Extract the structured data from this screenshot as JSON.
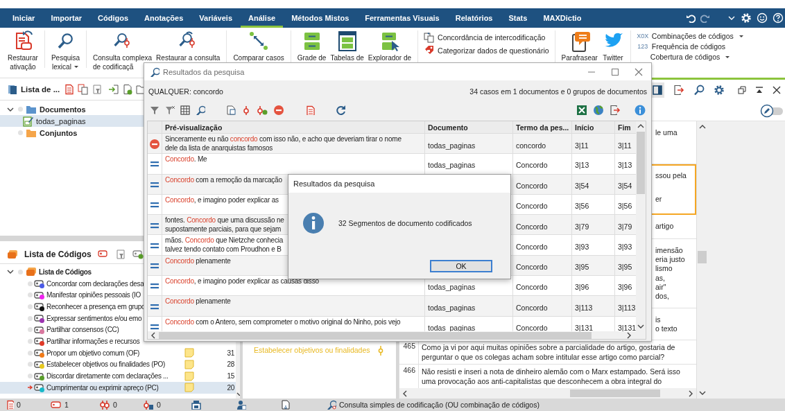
{
  "menu_bar": {
    "tabs": [
      {
        "label": "Iniciar",
        "selected": false
      },
      {
        "label": "Importar",
        "selected": false
      },
      {
        "label": "Códigos",
        "selected": false
      },
      {
        "label": "Anotações",
        "selected": false
      },
      {
        "label": "Variáveis",
        "selected": false
      },
      {
        "label": "Análise",
        "selected": true
      },
      {
        "label": "Métodos Mistos",
        "selected": false
      },
      {
        "label": "Ferramentas Visuais",
        "selected": false
      },
      {
        "label": "Relatórios",
        "selected": false
      },
      {
        "label": "Stats",
        "selected": false
      },
      {
        "label": "MAXDictio",
        "selected": false
      }
    ]
  },
  "ribbon": {
    "items": [
      {
        "kind": "large",
        "lines": [
          "Restaurar",
          "ativação"
        ],
        "dropdown": false
      },
      {
        "kind": "large",
        "lines": [
          "Pesquisa",
          "lexical"
        ],
        "dropdown": true
      },
      {
        "kind": "large",
        "lines": [
          "Consulta complexa",
          "de codificaçã"
        ],
        "dropdown": false
      },
      {
        "kind": "large",
        "lines": [
          "Restaurar a consulta"
        ],
        "dropdown": false
      },
      {
        "kind": "large",
        "lines": [
          "Comparar casos"
        ],
        "dropdown": false
      },
      {
        "kind": "large",
        "lines": [
          "Grade de"
        ],
        "dropdown": false
      },
      {
        "kind": "large",
        "lines": [
          "Tabelas de"
        ],
        "dropdown": false
      },
      {
        "kind": "large",
        "lines": [
          "Explorador de"
        ],
        "dropdown": false
      },
      {
        "kind": "stack",
        "entries": [
          {
            "label": "Concordância de intercodificação",
            "dropdown": false
          },
          {
            "label": "Categorizar dados de questionário",
            "dropdown": false
          }
        ]
      },
      {
        "kind": "large",
        "lines": [
          "Parafrasear"
        ],
        "dropdown": false
      },
      {
        "kind": "large",
        "lines": [
          "Twitter"
        ],
        "dropdown": false
      },
      {
        "kind": "stack",
        "entries": [
          {
            "glyph": "X0X",
            "label": "Combinações de códigos",
            "dropdown": true
          },
          {
            "glyph": "123",
            "label": "Frequência de códigos",
            "dropdown": false
          },
          {
            "label": "Cobertura de códigos",
            "dropdown": true
          }
        ]
      }
    ]
  },
  "document_browser": {
    "title": "Lista de ...",
    "tree": [
      {
        "label": "Documentos",
        "expanded": true,
        "selected": false,
        "children": [
          {
            "label": "todas_paginas",
            "selected": true
          }
        ]
      },
      {
        "label": "Conjuntos",
        "selected": false
      }
    ]
  },
  "code_system": {
    "title": "Lista de Códigos",
    "root": {
      "label": "Lista de Códigos",
      "expanded": true,
      "children": [
        {
          "label": "Concordar com declarações desa",
          "color": "#4a5ae6",
          "selected": false
        },
        {
          "label": "Manifestar opiniões pessoais (IO",
          "color": "#ee22ee",
          "selected": false
        },
        {
          "label": "Reconhecer a presença em grupo",
          "color": "#111111",
          "selected": false
        },
        {
          "label": "Expressar sentimentos e/ou emo",
          "color": "#9b34b0",
          "selected": false
        },
        {
          "label": "Partilhar consensos (CC)",
          "color": "#d9789f",
          "selected": false
        },
        {
          "label": "Partilhar informações e recursos",
          "color": "#e03a28",
          "selected": false
        },
        {
          "label": "Propor um objetivo comum (OF)",
          "color": "#f07a18",
          "selected": false,
          "memo": true,
          "count": "31"
        },
        {
          "label": "Estabelecer objetivos ou finalidades (PO)",
          "color": "#e6c81e",
          "selected": false,
          "memo": true,
          "count": "28"
        },
        {
          "label": "Discordar diretamente com declarações ...",
          "color": "#5a9e2a",
          "selected": false,
          "memo": true,
          "count": "15"
        },
        {
          "label": "Cumprimentar ou exprimir apreço (PC)",
          "color": "#18b8c8",
          "selected": true,
          "memo": true,
          "count": "20"
        }
      ]
    }
  },
  "retrieved_segments": {
    "code_label": "Estabelecer objetivos ou finalidades"
  },
  "document_viewer": {
    "fragments": [
      {
        "lines": [
          "le uma"
        ],
        "highlighted": false
      },
      {
        "lines": [
          "ssou pela",
          "er"
        ],
        "highlighted": true
      },
      {
        "lines": [
          "artigo"
        ],
        "highlighted": false
      },
      {
        "lines": [
          "imensão",
          "eria justo",
          "lismo",
          "as,",
          "air\"",
          "dos,"
        ],
        "highlighted": false
      },
      {
        "lines": [
          "is",
          "o texto"
        ],
        "highlighted": false
      }
    ],
    "paragraphs": [
      {
        "number": "465",
        "text": "Como ja vi por aqui muitas opiniões sobre a parcialidade do artigo, gostaria de perguntar o que os colegas acham sobre intitular esse artigo como parcial?"
      },
      {
        "number": "466",
        "text": "Não resisti e inseri a nota de dinheiro alemão com o Marx estampado. Será isso uma provocação aos anti-capitalistas que desconhecem a obra integral do"
      }
    ]
  },
  "status_bar": {
    "counters": [
      "0",
      "1",
      "0",
      "0"
    ],
    "query": "Consulta simples de codificação (OU combinação de códigos)"
  },
  "results_window": {
    "title": "Resultados da pesquisa",
    "query": "QUALQUER: concordo",
    "summary": "34 casos em 1 documentos e 0 grupos de documentos",
    "columns": [
      "Pré-visualização",
      "Documento",
      "Termo da pes...",
      "Início",
      "Fim"
    ],
    "rows": [
      {
        "kind": "excluded",
        "preview": [
          {
            "text": "Sinceramente eu não ",
            "hit": false
          },
          {
            "text": "concordo",
            "hit": true
          },
          {
            "text": " com isso não, e acho que deveriam tirar o nome\ndele da lista de anarquistas famosos",
            "hit": false
          }
        ],
        "document": "todas_paginas",
        "term": "concordo",
        "start": "3|11",
        "end": "3|11"
      },
      {
        "kind": "match",
        "preview": [
          {
            "text": "Concordo",
            "hit": true
          },
          {
            "text": ". Me",
            "hit": false
          }
        ],
        "document": "todas_paginas",
        "term": "Concordo",
        "start": "3|13",
        "end": "3|13"
      },
      {
        "kind": "match",
        "preview": [
          {
            "text": "Concordo",
            "hit": true
          },
          {
            "text": " com a remoção da marcação",
            "hit": false
          }
        ],
        "term": "Concordo",
        "start": "3|54",
        "end": "3|54"
      },
      {
        "kind": "match",
        "preview": [
          {
            "text": "Concordo",
            "hit": true
          },
          {
            "text": ", e imagino poder explicar as",
            "hit": false
          }
        ],
        "term": "Concordo",
        "start": "3|56",
        "end": "3|56"
      },
      {
        "kind": "match",
        "preview": [
          {
            "text": "fontes. ",
            "hit": false
          },
          {
            "text": "Concordo",
            "hit": true
          },
          {
            "text": " que uma discussão ne\nsupostamente parciais, para que sejam",
            "hit": false
          }
        ],
        "term": "Concordo",
        "start": "3|79",
        "end": "3|79"
      },
      {
        "kind": "match",
        "preview": [
          {
            "text": "mãos. ",
            "hit": false
          },
          {
            "text": "Concordo",
            "hit": true
          },
          {
            "text": " que Nietzche conhecia\ntalvez tendo contato com Proudhon e B",
            "hit": false
          }
        ],
        "term": "Concordo",
        "start": "3|93",
        "end": "3|93"
      },
      {
        "kind": "match",
        "preview": [
          {
            "text": "Concordo",
            "hit": true
          },
          {
            "text": " plenamente",
            "hit": false
          }
        ],
        "term": "Concordo",
        "start": "3|95",
        "end": "3|95"
      },
      {
        "kind": "match",
        "preview": [
          {
            "text": "Concordo",
            "hit": true
          },
          {
            "text": ", e imagino poder explicar as causas disso",
            "hit": false
          }
        ],
        "document": "todas_paginas",
        "term": "Concordo",
        "start": "3|96",
        "end": "3|96"
      },
      {
        "kind": "match",
        "preview": [
          {
            "text": "Concordo",
            "hit": true
          },
          {
            "text": " plenamente",
            "hit": false
          }
        ],
        "document": "todas_paginas",
        "term": "Concordo",
        "start": "3|113",
        "end": "3|113"
      },
      {
        "kind": "match",
        "preview": [
          {
            "text": "Concordo",
            "hit": true
          },
          {
            "text": " com o Antero, sem comprometer o motivo original do Ninho, pois vejo",
            "hit": false
          }
        ],
        "document": "todas_paginas",
        "term": "Concordo",
        "start": "3|131",
        "end": "3|131"
      }
    ]
  },
  "dialog": {
    "title": "Resultados da pesquisa",
    "message": "32 Segmentos de documento codificados",
    "button": "OK"
  }
}
